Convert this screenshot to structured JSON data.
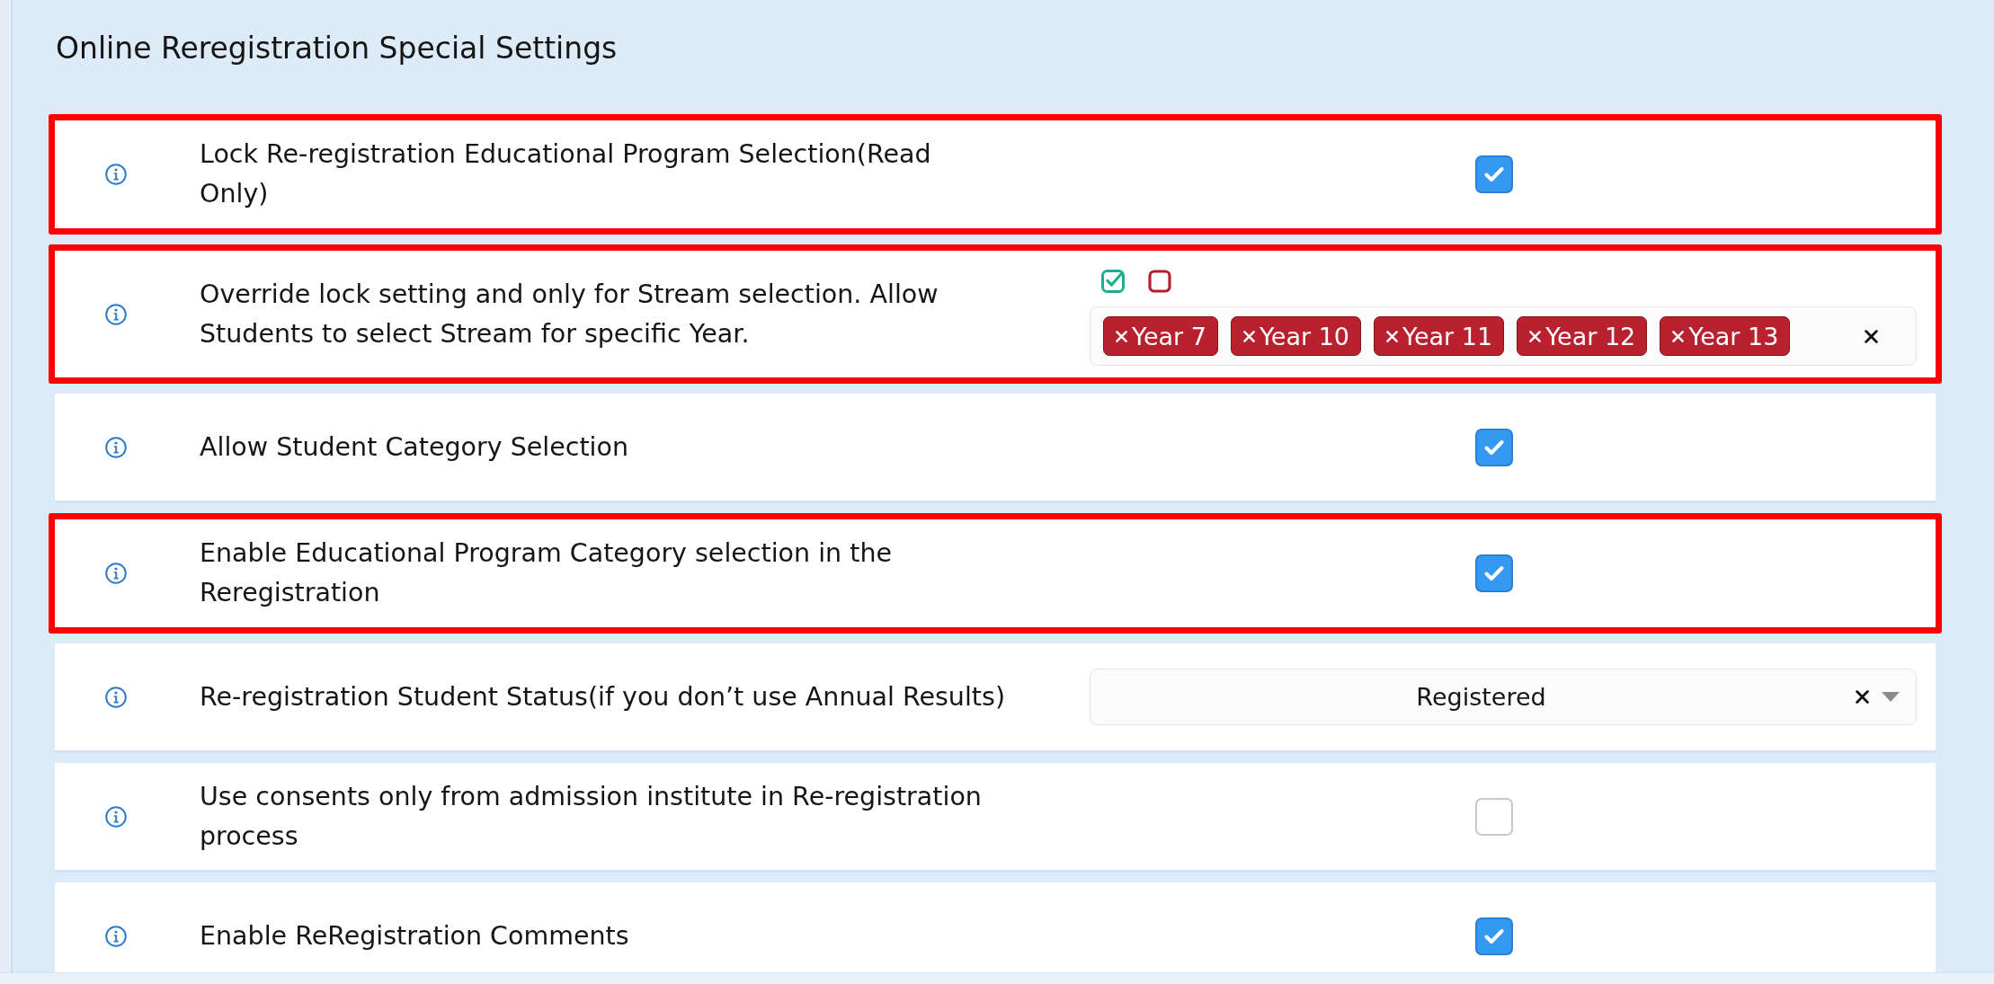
{
  "title": "Online Reregistration Special Settings",
  "settings": [
    {
      "kind": "checkbox",
      "label": "Lock Re-registration Educational Program Selection(Read Only)",
      "highlighted": true,
      "checked": true
    },
    {
      "kind": "tags",
      "label": "Override lock setting and only for Stream selection. Allow Students to select Stream for specific Year.",
      "highlighted": true,
      "tags": [
        "Year 7",
        "Year 10",
        "Year 11",
        "Year 12",
        "Year 13"
      ]
    },
    {
      "kind": "checkbox",
      "label": "Allow Student Category Selection",
      "highlighted": false,
      "checked": true
    },
    {
      "kind": "checkbox",
      "label": "Enable Educational Program Category selection in the Reregistration",
      "highlighted": true,
      "checked": true
    },
    {
      "kind": "select",
      "label": "Re-registration Student Status(if you don’t use Annual Results)",
      "highlighted": false,
      "value": "Registered"
    },
    {
      "kind": "checkbox",
      "label": "Use consents only from admission institute in Re-registration process",
      "highlighted": false,
      "checked": false
    },
    {
      "kind": "checkbox",
      "label": "Enable ReRegistration Comments",
      "highlighted": false,
      "checked": true
    }
  ]
}
